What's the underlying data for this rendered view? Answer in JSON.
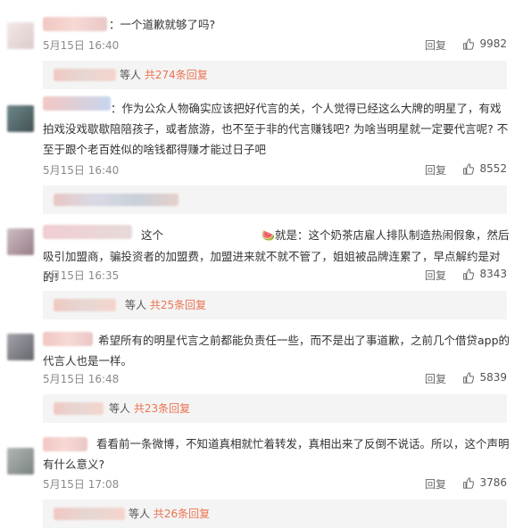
{
  "comments": [
    {
      "text": "：一个道歉就够了吗?",
      "time": "5月15日 16:40",
      "reply": "回复",
      "likes": "9982",
      "sub_prefix": "等人",
      "sub_count": "共274条回复"
    },
    {
      "text": "：作为公众人物确实应该把好代言的关，个人觉得已经这么大牌的明星了，有戏拍戏没戏歇歇陪陪孩子，或者旅游，也不至于非的代言赚钱吧? 为啥当明星就一定要代言呢? 不至于跟个老百姓似的啥钱都得赚才能过日子吧",
      "time": "5月15日 16:40",
      "reply": "回复",
      "likes": "8552"
    },
    {
      "text_pre": "这个",
      "emoji": "🍉",
      "text": "就是：这个奶茶店雇人排队制造热闹假象，然后吸引加盟商，骗投资者的加盟费，加盟进来就不就不管了，姐姐被品牌连累了，早点解约是对的!",
      "time": "5月15日 16:35",
      "reply": "回复",
      "likes": "8343",
      "sub_prefix": "等人",
      "sub_count": "共25条回复"
    },
    {
      "text": "希望所有的明星代言之前都能负责任一些，而不是出了事道歉，之前几个借贷app的代言人也是一样。",
      "time": "5月15日 16:48",
      "reply": "回复",
      "likes": "5839",
      "sub_prefix": "等人",
      "sub_count": "共23条回复"
    },
    {
      "text": "看看前一条微博，不知道真相就忙着转发，真相出来了反倒不说话。所以，这个声明有什么意义?",
      "time": "5月15日 17:08",
      "reply": "回复",
      "likes": "3786",
      "sub_prefix": "等人",
      "sub_count": "共26条回复"
    }
  ],
  "icons": {
    "like": "thumbs-up-icon",
    "emoji": "watermelon-icon"
  },
  "colors": {
    "accent": "#eb7350",
    "sub_bg": "#f4f4f4",
    "meta": "#8a8a8a"
  }
}
